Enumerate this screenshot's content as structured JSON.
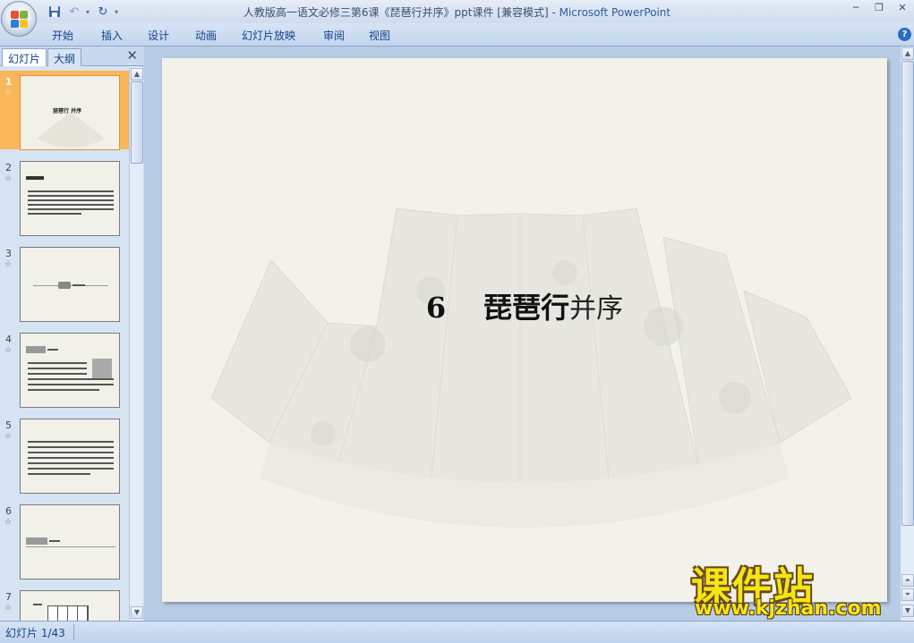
{
  "window": {
    "title_doc": "人教版高一语文必修三第6课《琵琶行并序》ppt课件 [兼容模式]",
    "title_sep": " - ",
    "title_app": "Microsoft PowerPoint"
  },
  "ribbon": {
    "tabs": [
      "开始",
      "插入",
      "设计",
      "动画",
      "幻灯片放映",
      "审阅",
      "视图"
    ]
  },
  "pane": {
    "tab_slides": "幻灯片",
    "tab_outline": "大纲",
    "close": "✕",
    "thumbnails": [
      {
        "num": "1",
        "star": "☆",
        "text": "琵琶行 并序"
      },
      {
        "num": "2",
        "star": "☆"
      },
      {
        "num": "3",
        "star": "☆"
      },
      {
        "num": "4",
        "star": "☆"
      },
      {
        "num": "5",
        "star": "☆"
      },
      {
        "num": "6",
        "star": "☆"
      },
      {
        "num": "7",
        "star": "☆"
      }
    ]
  },
  "slide": {
    "number": "6",
    "title_main": "琵琶行",
    "title_sub": "并序"
  },
  "watermark": {
    "logo_text": "课件站",
    "url": "www.kjzhan.com"
  },
  "statusbar": {
    "slide_info": "幻灯片 1/43"
  },
  "colors": {
    "ribbon_text": "#15428b",
    "selection": "#f9b65a",
    "slide_bg": "#f2f1ea"
  }
}
